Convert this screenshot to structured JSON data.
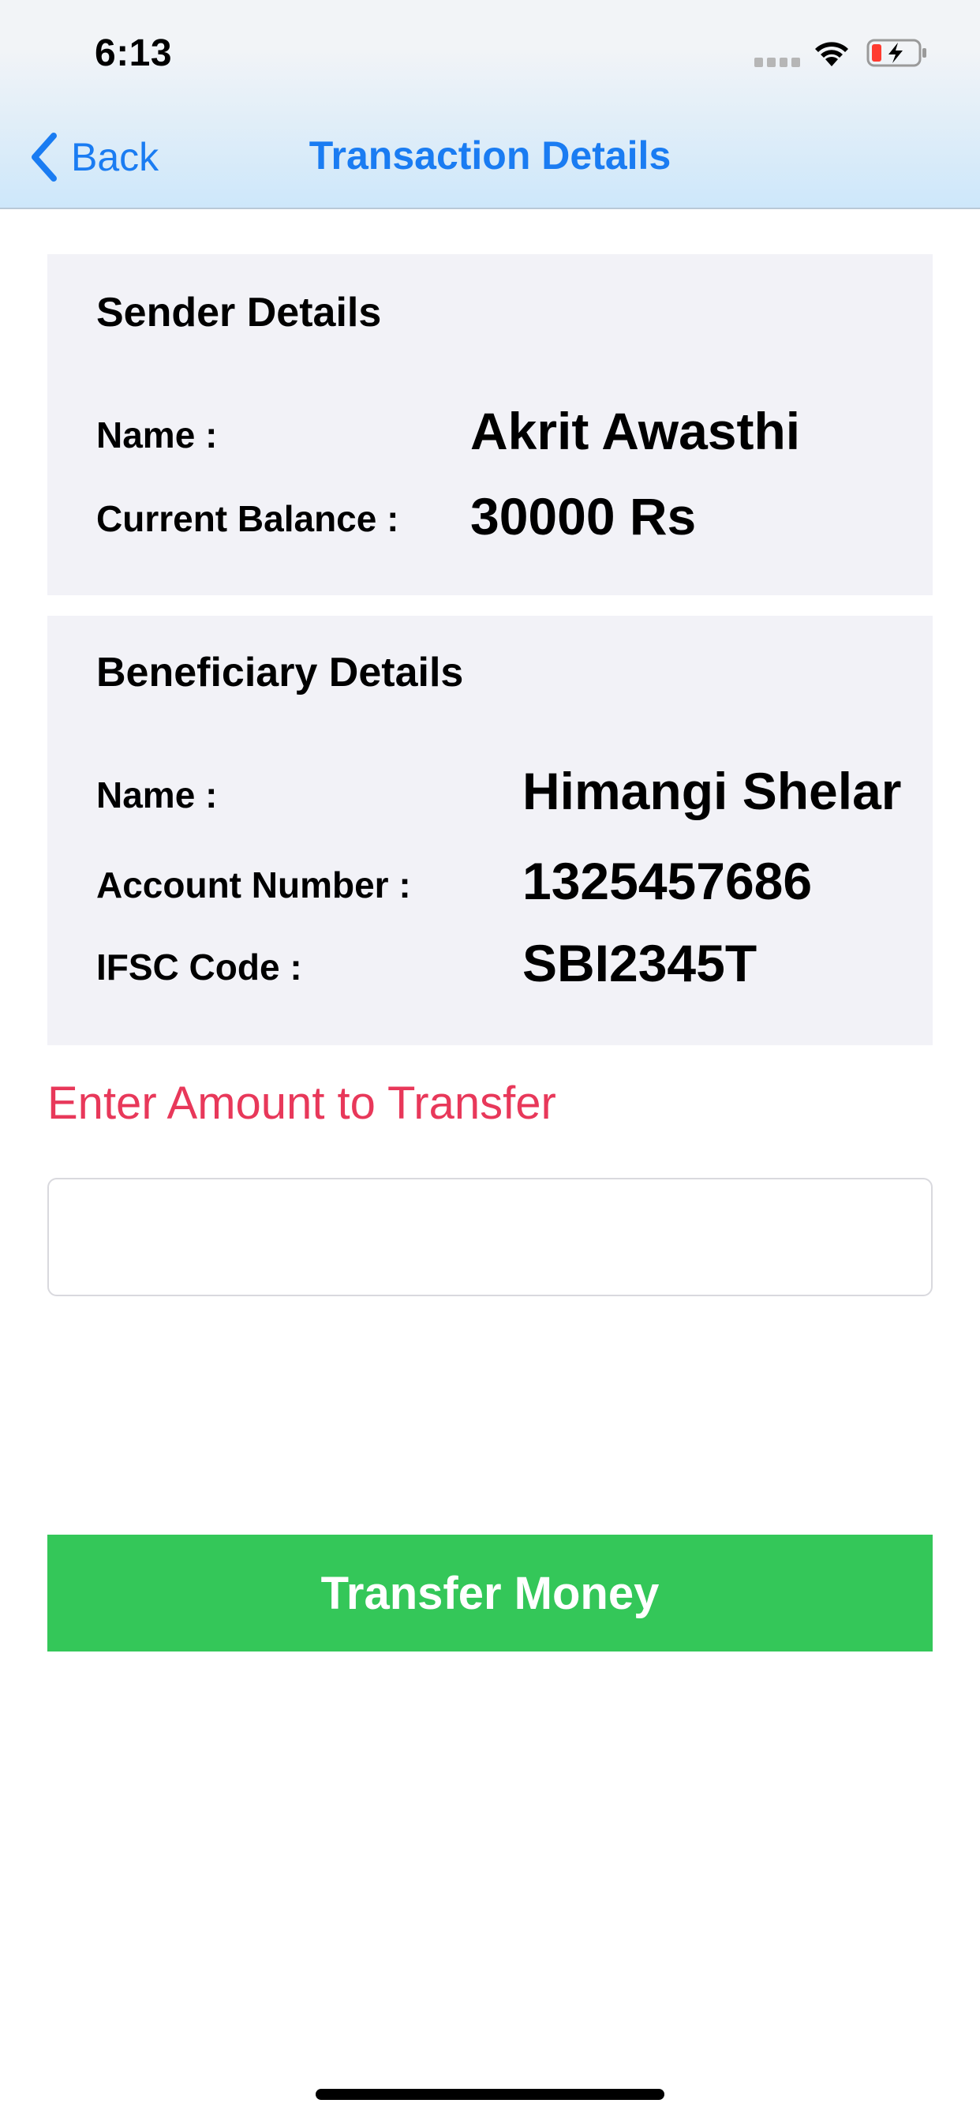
{
  "status_bar": {
    "time": "6:13",
    "icons": [
      "cellular-signal-icon",
      "wifi-icon",
      "battery-charging-icon"
    ]
  },
  "nav": {
    "back_label": "Back",
    "title": "Transaction Details",
    "accent_color": "#1a7cf2"
  },
  "sender": {
    "title": "Sender Details",
    "name_label": "Name :",
    "name_value": "Akrit Awasthi",
    "balance_label": "Current Balance :",
    "balance_value": "30000 Rs"
  },
  "beneficiary": {
    "title": "Beneficiary Details",
    "name_label": "Name :",
    "name_value": "Himangi Shelar",
    "account_label": "Account Number :",
    "account_value": "1325457686",
    "ifsc_label": "IFSC Code :",
    "ifsc_value": "SBI2345T"
  },
  "amount": {
    "label": "Enter Amount to Transfer",
    "label_color": "#e8385a",
    "input_value": "",
    "placeholder": ""
  },
  "actions": {
    "transfer_label": "Transfer Money",
    "button_color": "#34c759"
  }
}
